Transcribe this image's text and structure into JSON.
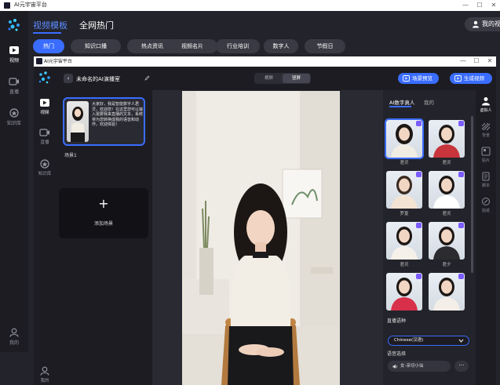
{
  "outer_window": {
    "title": "AI元宇宙平台",
    "controls": {
      "minimize": "—",
      "maximize": "☐",
      "close": "✕"
    }
  },
  "outer_header": {
    "tabs": [
      {
        "label": "视频模板",
        "active": true
      },
      {
        "label": "全网热门",
        "active": false
      }
    ],
    "my_video_label": "我的视频",
    "categories": [
      {
        "label": "热门",
        "active": true
      },
      {
        "label": "知识口播",
        "active": false
      },
      {
        "label": "热点资讯",
        "active": false
      },
      {
        "label": "视频名片",
        "active": false
      },
      {
        "label": "行业培训",
        "active": false
      },
      {
        "label": "数字人",
        "active": false
      },
      {
        "label": "节假日",
        "active": false
      }
    ]
  },
  "outer_sidebar": {
    "items": [
      {
        "label": "视频",
        "icon": "video-icon",
        "active": true
      },
      {
        "label": "直播",
        "icon": "live-icon",
        "active": false
      },
      {
        "label": "知识库",
        "icon": "knowledge-icon",
        "active": false
      }
    ],
    "bottom_label": "我的"
  },
  "inner_window": {
    "title": "AI元宇宙平台",
    "controls": {
      "minimize": "—",
      "maximize": "☐",
      "close": "✕"
    },
    "project_title": "未命名的AI演播室",
    "orientation": [
      {
        "label": "横屏",
        "active": false
      },
      {
        "label": "竖屏",
        "active": true
      }
    ],
    "preview_button": "场景预览",
    "generate_button": "生成视频"
  },
  "inner_sidebar": {
    "items": [
      {
        "label": "视频",
        "icon": "video-icon",
        "active": true
      },
      {
        "label": "直播",
        "icon": "live-icon",
        "active": false
      },
      {
        "label": "知识库",
        "icon": "knowledge-icon",
        "active": false
      }
    ],
    "bottom_label": "我的"
  },
  "scenes": {
    "scene_text": "大家好，我是智能数字人君灵，欢迎您！在这里您可以输入需要我来直播的文本，系统将为您转换成我的语音和动作，欢迎体验！",
    "scene_label": "场景1",
    "add_scene_label": "添加场景"
  },
  "right_panel": {
    "tabs": [
      {
        "label": "AI数字真人",
        "active": true
      },
      {
        "label": "我的",
        "active": false
      }
    ],
    "avatars": [
      {
        "name": "君灵",
        "selected": true
      },
      {
        "name": "君灵",
        "selected": false
      },
      {
        "name": "罗夏",
        "selected": false
      },
      {
        "name": "君灵",
        "selected": false
      },
      {
        "name": "君灵",
        "selected": false
      },
      {
        "name": "君夕",
        "selected": false
      },
      {
        "name": "",
        "selected": false
      },
      {
        "name": "",
        "selected": false
      }
    ],
    "language_label": "直播语种",
    "language_value": "Chinese(汉语)",
    "voice_label": "语音选择",
    "voice_value": "女-亲切小仙",
    "more_label": "···"
  },
  "right_toolbar": {
    "items": [
      {
        "label": "虚拟人",
        "icon": "person-icon",
        "active": true
      },
      {
        "label": "背景",
        "icon": "background-icon",
        "active": false
      },
      {
        "label": "贴片",
        "icon": "sticker-icon",
        "active": false
      },
      {
        "label": "脚本",
        "icon": "script-icon",
        "active": false
      },
      {
        "label": "贴纸",
        "icon": "tag-icon",
        "active": false
      }
    ]
  },
  "colors": {
    "accent": "#3a6dff",
    "dark_bg": "#23232b",
    "panel_bg": "#1c1c22"
  }
}
